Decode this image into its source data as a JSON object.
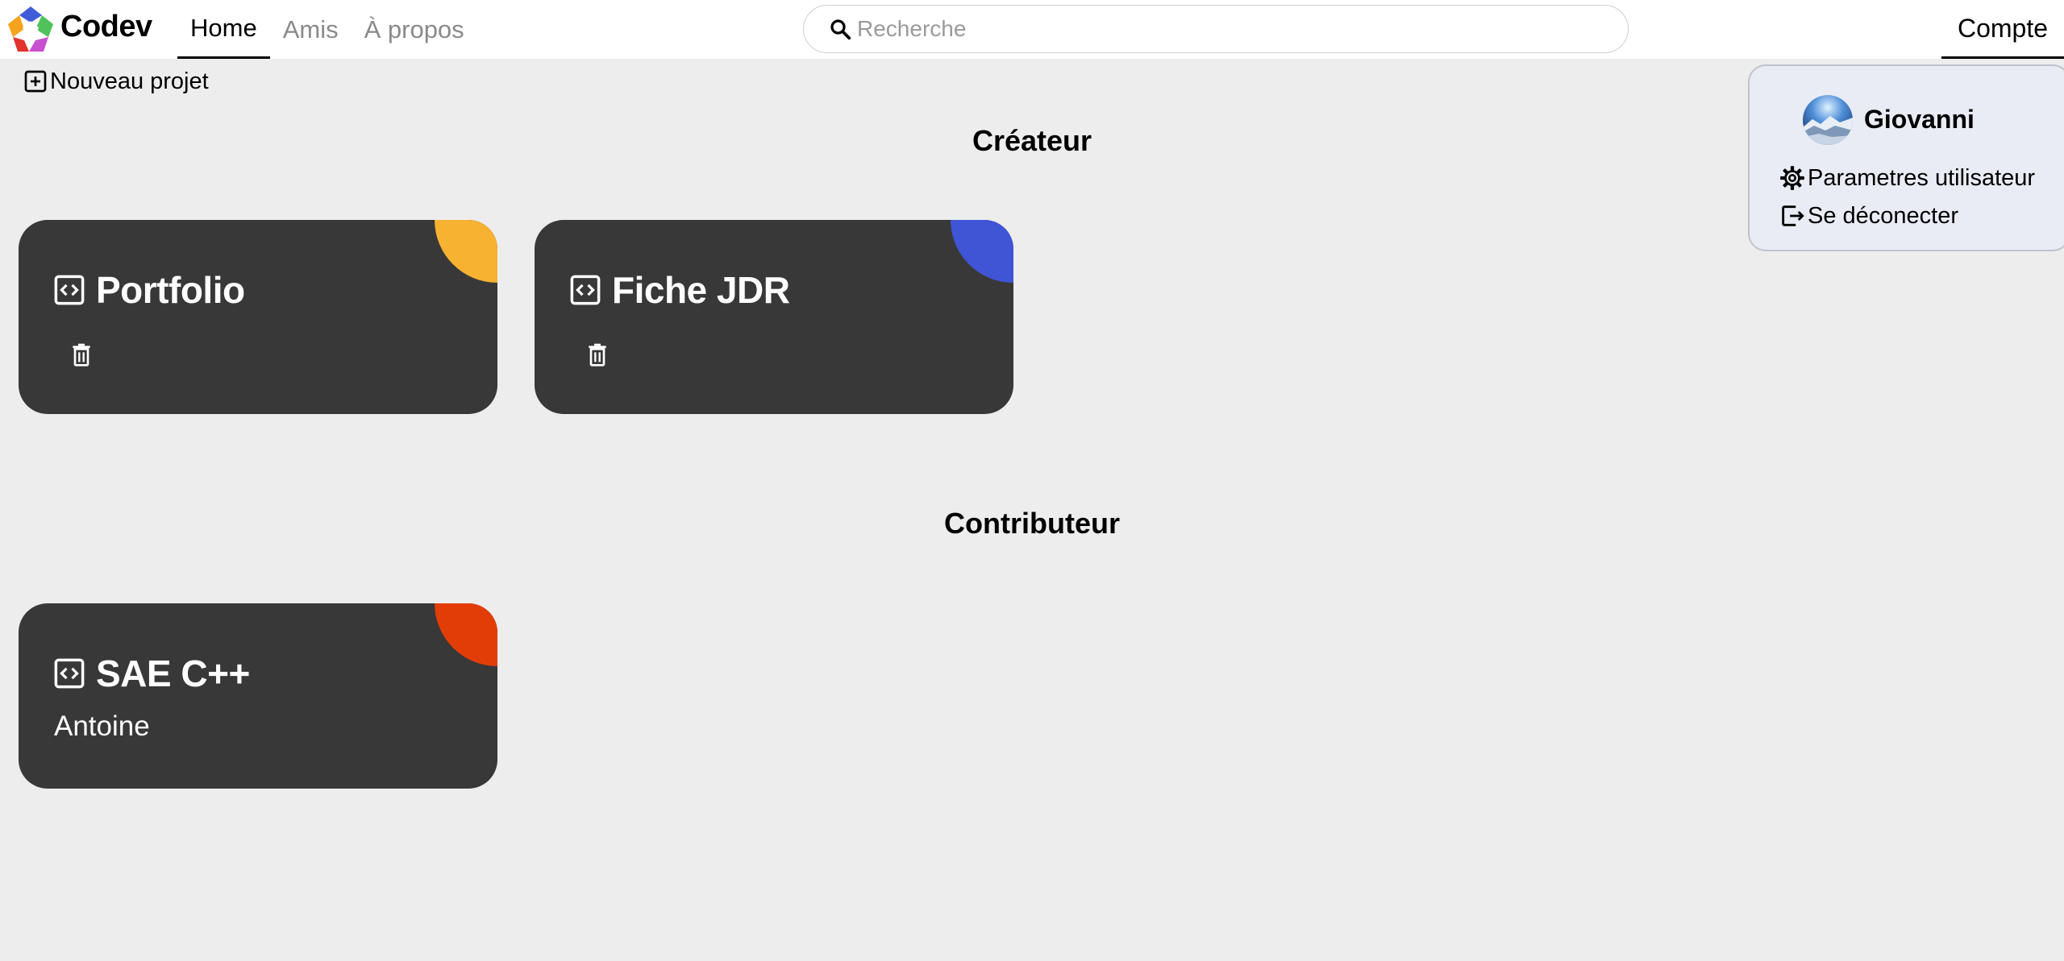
{
  "header": {
    "brand": "Codev",
    "nav": [
      {
        "label": "Home",
        "active": true
      },
      {
        "label": "Amis",
        "active": false
      },
      {
        "label": "À propos",
        "active": false
      }
    ],
    "search": {
      "placeholder": "Recherche",
      "value": ""
    },
    "account_label": "Compte"
  },
  "toolbar": {
    "new_project_label": "Nouveau projet"
  },
  "sections": {
    "creator": {
      "title": "Créateur",
      "projects": [
        {
          "title": "Portfolio",
          "accent": "#f7b232"
        },
        {
          "title": "Fiche JDR",
          "accent": "#4054d6"
        }
      ]
    },
    "contributor": {
      "title": "Contributeur",
      "projects": [
        {
          "title": "SAE C++",
          "owner": "Antoine",
          "accent": "#e23d06"
        }
      ]
    }
  },
  "account_menu": {
    "username": "Giovanni",
    "settings_label": "Parametres utilisateur",
    "logout_label": "Se déconecter"
  },
  "colors": {
    "card_bg": "#383838",
    "page_bg": "#ededed",
    "dropdown_bg": "#e9ecf4",
    "logo": [
      "#3f5cd8",
      "#4fc25a",
      "#c94fd1",
      "#e2332e",
      "#f7a21c"
    ]
  },
  "icons": {
    "logo": "codev-pentagon-logo",
    "search": "search-icon",
    "new_project": "plus-square-icon",
    "project": "code-square-icon",
    "delete": "trash-icon",
    "settings": "gear-icon",
    "logout": "logout-icon"
  }
}
